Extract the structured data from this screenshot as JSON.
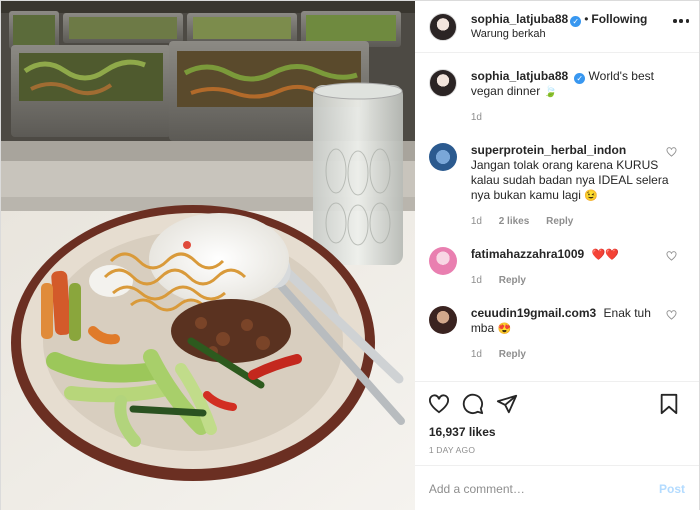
{
  "header": {
    "username": "sophia_latjuba88",
    "separator": "•",
    "follow_label": "Following",
    "location": "Warung berkah"
  },
  "caption": {
    "username": "sophia_latjuba88",
    "text": "World's best vegan dinner",
    "emoji": "🍃",
    "time": "1d"
  },
  "comments": [
    {
      "username": "superprotein_herbal_indon",
      "text": "Jangan tolak orang karena KURUS kalau sudah badan nya IDEAL selera nya bukan kamu lagi",
      "emoji": "😉",
      "time": "1d",
      "likes": "2 likes",
      "reply": "Reply"
    },
    {
      "username": "fatimahazzahra1009",
      "text": "",
      "emoji": "❤️❤️",
      "time": "1d",
      "likes": "",
      "reply": "Reply"
    },
    {
      "username": "ceuudin19gmail.com3",
      "text": "Enak tuh mba",
      "emoji": "😍",
      "time": "1d",
      "likes": "",
      "reply": "Reply"
    }
  ],
  "actions": {
    "icons": [
      "heart-icon",
      "comment-icon",
      "share-icon",
      "bookmark-icon"
    ]
  },
  "likes_text": "16,937 likes",
  "date_text": "1 DAY AGO",
  "add_comment": {
    "placeholder": "Add a comment…",
    "post_label": "Post"
  },
  "colors": {
    "verified": "#3897f0",
    "post_button": "#b3dbff",
    "heart": "#ed4956",
    "muted": "#8e8e8e"
  }
}
